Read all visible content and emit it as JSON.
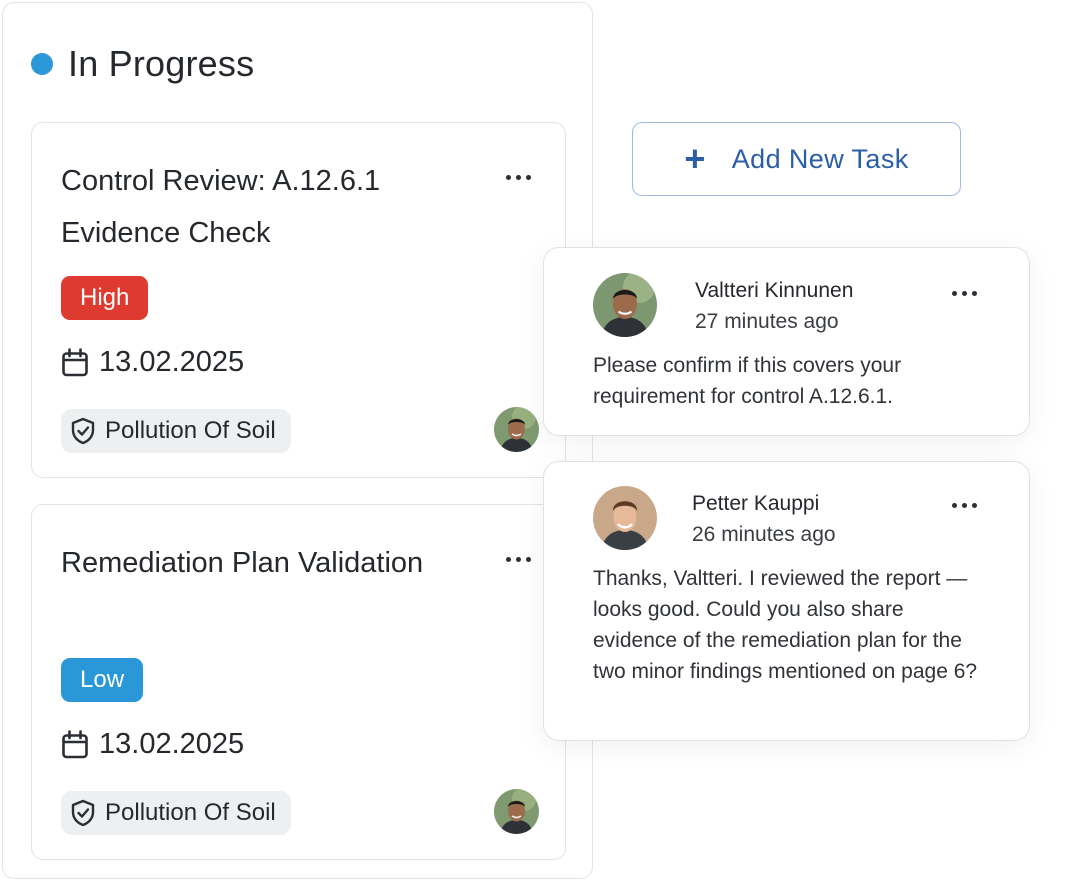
{
  "column": {
    "title": "In Progress",
    "status_color": "#2a97d9"
  },
  "tasks": [
    {
      "title": "Control Review: A.12.6.1 Evidence Check",
      "priority": "High",
      "priority_color": "#df3a2f",
      "date": "13.02.2025",
      "tag": "Pollution Of Soil",
      "icons": [
        "more-icon",
        "calendar-icon",
        "shield-check-icon",
        "avatar"
      ]
    },
    {
      "title": "Remediation Plan Validation",
      "priority": "Low",
      "priority_color": "#2a97d9",
      "date": "13.02.2025",
      "tag": "Pollution Of Soil",
      "icons": [
        "more-icon",
        "calendar-icon",
        "shield-check-icon",
        "avatar"
      ]
    }
  ],
  "add_task": {
    "label": "Add New Task",
    "icon": "plus-icon",
    "color": "#2a5ea8"
  },
  "comments": [
    {
      "author": "Valtteri Kinnunen",
      "time": "27 minutes ago",
      "text": "Please confirm if this covers your requirement for control A.12.6.1."
    },
    {
      "author": "Petter Kauppi",
      "time": "26 minutes ago",
      "text": "Thanks, Valtteri. I reviewed the report — looks good. Could you also share evidence of the remediation plan for the two minor findings mentioned on page 6?"
    }
  ]
}
